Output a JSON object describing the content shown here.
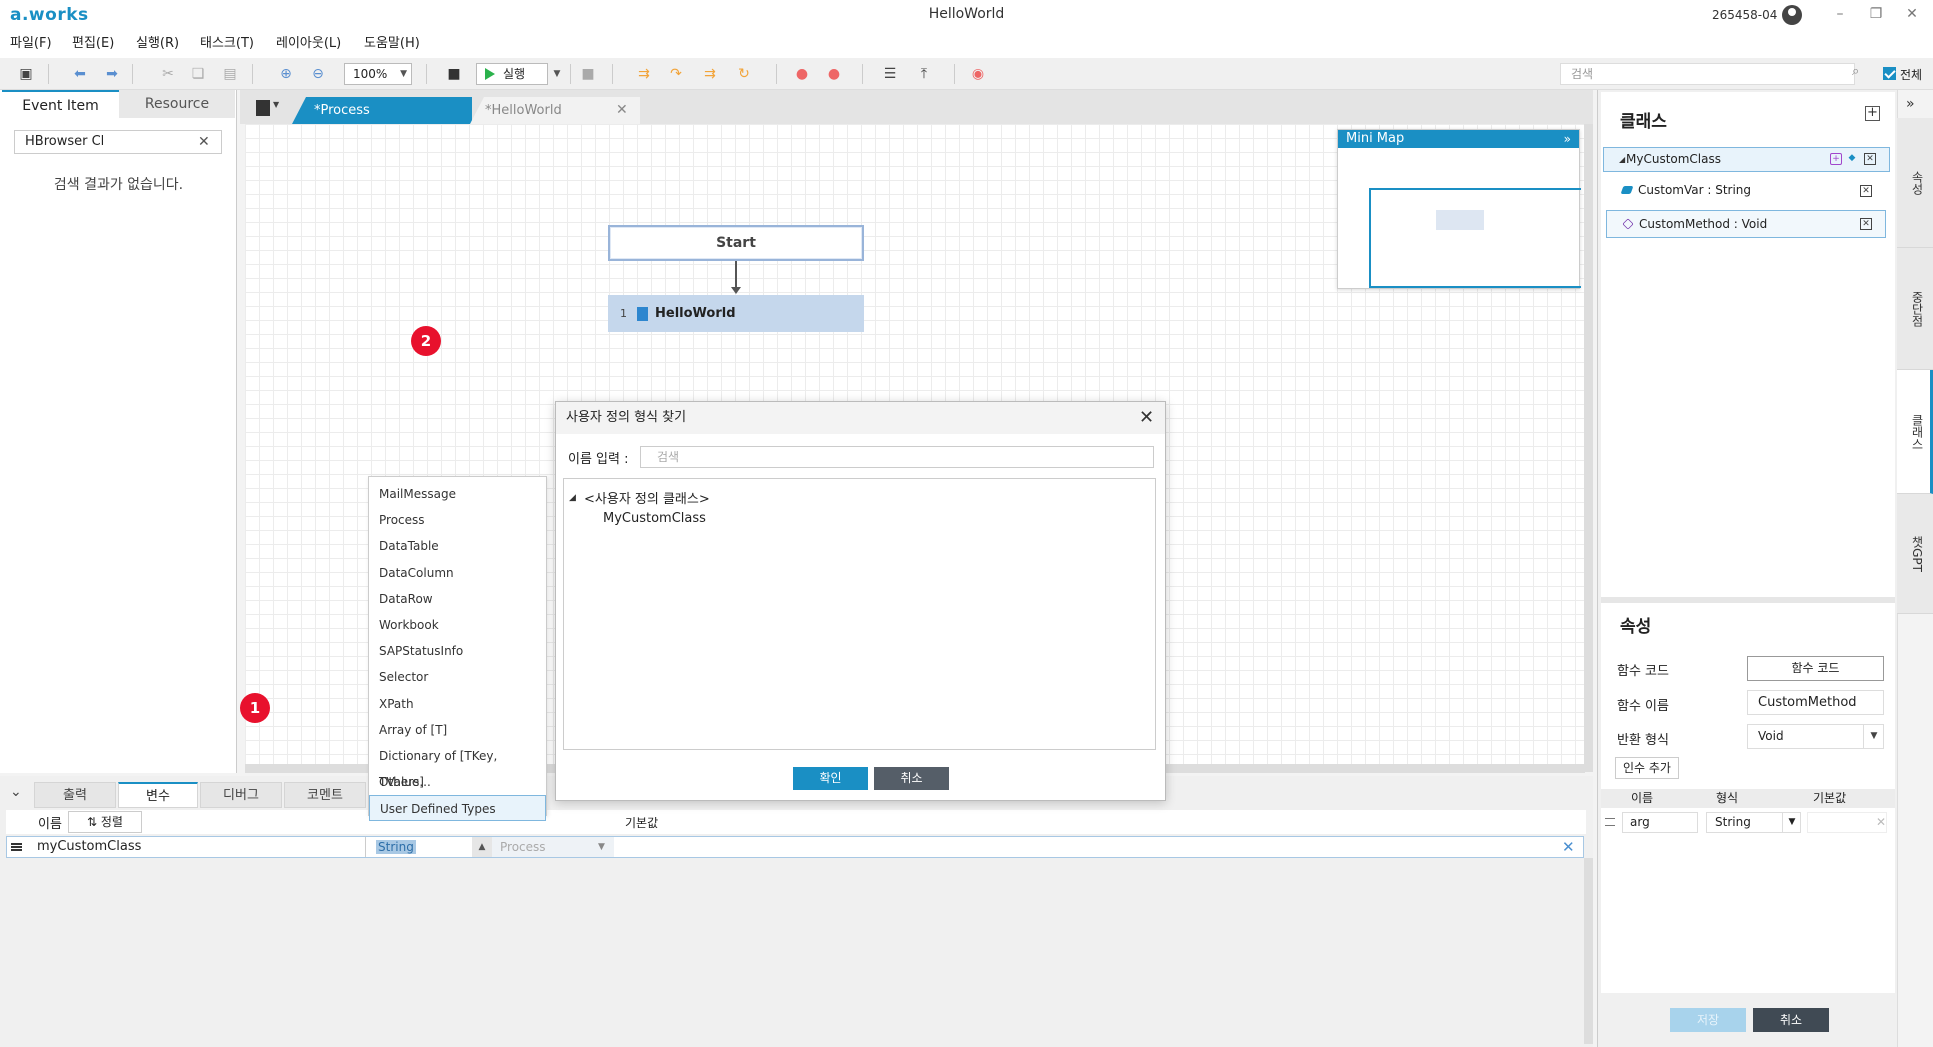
{
  "app": {
    "logo": "a.works",
    "window_title": "HelloWorld",
    "user_id": "265458-04",
    "window_controls": {
      "minimize": "–",
      "restore": "❐",
      "close": "✕"
    }
  },
  "menu": [
    "파일(F)",
    "편집(E)",
    "실행(R)",
    "태스크(T)",
    "레이아웃(L)",
    "도움말(H)"
  ],
  "toolbar": {
    "zoom": "100%",
    "run_label": "실행",
    "search_placeholder": "검색",
    "all_label": "전체",
    "all_checked": true
  },
  "left_panel": {
    "tabs": [
      "Event Item",
      "Resource"
    ],
    "active_tab": "Event Item",
    "search_value": "HBrowser Cl",
    "empty_message": "검색 결과가 없습니다."
  },
  "doc_tabs": [
    {
      "label": "*Process",
      "active": true
    },
    {
      "label": "*HelloWorld",
      "active": false
    }
  ],
  "canvas": {
    "start_node": "Start",
    "step": {
      "number": "1",
      "label": "HelloWorld"
    },
    "minimap_title": "Mini Map",
    "minimap_collapse": "»"
  },
  "bottom_panel": {
    "tabs": [
      "출력",
      "변수",
      "디버그",
      "코멘트"
    ],
    "active_tab": "변수",
    "columns": {
      "name": "이름",
      "sort": "⇅ 정렬",
      "default": "기본값"
    },
    "variable": {
      "name": "myCustomClass",
      "type": "String",
      "scope": "Process"
    }
  },
  "type_list": {
    "items": [
      "MailMessage",
      "Process",
      "DataTable",
      "DataColumn",
      "DataRow",
      "Workbook",
      "SAPStatusInfo",
      "Selector",
      "XPath",
      "Array of [T]",
      "Dictionary of [TKey, TValue]",
      "Others...",
      "User Defined Types"
    ],
    "selected": "User Defined Types"
  },
  "badges": {
    "one": "1",
    "two": "2"
  },
  "dialog": {
    "title": "사용자 정의 형식 찾기",
    "name_label": "이름 입력 :",
    "search_placeholder": "검색",
    "tree_group": "<사용자 정의 클래스>",
    "tree_item": "MyCustomClass",
    "ok": "확인",
    "cancel": "취소"
  },
  "right_panel": {
    "class_title": "클래스",
    "class_name": "MyCustomClass",
    "members": [
      {
        "label": "CustomVar : String",
        "kind": "variable"
      },
      {
        "label": "CustomMethod : Void",
        "kind": "method"
      }
    ],
    "props_title": "속성",
    "props": {
      "code_label": "함수 코드",
      "code_button": "함수 코드",
      "fname_label": "함수 이름",
      "fname_value": "CustomMethod",
      "return_label": "반환 형식",
      "return_value": "Void",
      "add_arg": "인수 추가"
    },
    "arg_columns": [
      "이름",
      "형식",
      "기본값"
    ],
    "arg": {
      "name": "arg",
      "type": "String",
      "default": ""
    },
    "save": "저장",
    "cancel": "취소"
  },
  "side_tabs": [
    "속성",
    "중단점",
    "클래스",
    "챗GPT"
  ],
  "active_side_tab": "클래스",
  "colors": {
    "accent": "#1a8fc4",
    "badge": "#e8112d",
    "selected_row": "#e8f3fb",
    "node_fill": "#c5d7ec"
  }
}
